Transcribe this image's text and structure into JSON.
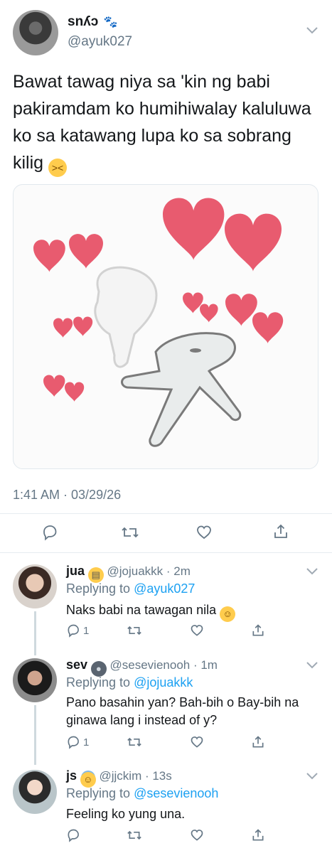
{
  "main_tweet": {
    "display_name": "snʎɔ",
    "name_emoji": "🐾",
    "handle": "@ayuk027",
    "text": "Bawat tawag niya sa 'kin ng babi pakiramdam ko humihiwalay kaluluwa ko sa katawang lupa ko sa sobrang kilig",
    "text_emoji": "confounded-face",
    "timestamp": "1:41 AM · 03/29/26"
  },
  "replies": [
    {
      "display_name": "jua",
      "name_emoji": "grimacing-face",
      "handle": "@jojuakkk",
      "time": "· 2m",
      "replying_label": "Replying to",
      "replying_to": "@ayuk027",
      "text": "Naks babi na tawagan nila",
      "text_emoji": "rolling-on-floor-laughing",
      "reply_count": "1"
    },
    {
      "display_name": "sev",
      "name_emoji": "new-moon-face",
      "handle": "@sesevienooh",
      "time": "· 1m",
      "replying_label": "Replying to",
      "replying_to": "@jojuakkk",
      "text": "Pano basahin yan? Bah-bih o Bay-bih na ginawa lang i instead of y?",
      "reply_count": "1"
    },
    {
      "display_name": "js",
      "name_emoji": "smiling-face-with-halo",
      "handle": "@jjckim",
      "time": "· 13s",
      "replying_label": "Replying to",
      "replying_to": "@sesevienooh",
      "text": "Feeling ko yung una.",
      "reply_count": ""
    }
  ],
  "colors": {
    "link": "#1da1f2",
    "secondary": "#657786",
    "heart": "#e85b6f"
  }
}
